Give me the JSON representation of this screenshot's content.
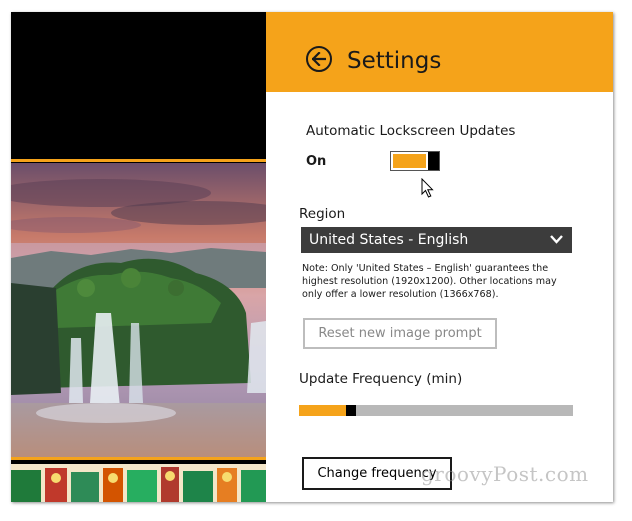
{
  "colors": {
    "accent": "#f5a31a",
    "dropdown_bg": "#3c3c3c",
    "slider_track": "#b8b8b8"
  },
  "header": {
    "title": "Settings",
    "back_icon": "back-arrow-icon"
  },
  "lockscreen": {
    "label": "Automatic Lockscreen Updates",
    "toggle_state": "On",
    "toggle_on": true
  },
  "region": {
    "label": "Region",
    "selected": "United States - English",
    "note": "Note: Only 'United States – English' guarantees the highest resolution (1920x1200). Other locations may only offer a lower resolution (1366x768)."
  },
  "reset_button": "Reset new image prompt",
  "frequency": {
    "label": "Update Frequency (min)",
    "level_fraction": 0.17
  },
  "change_button": "Change frequency",
  "watermark": "groovyPost.com"
}
